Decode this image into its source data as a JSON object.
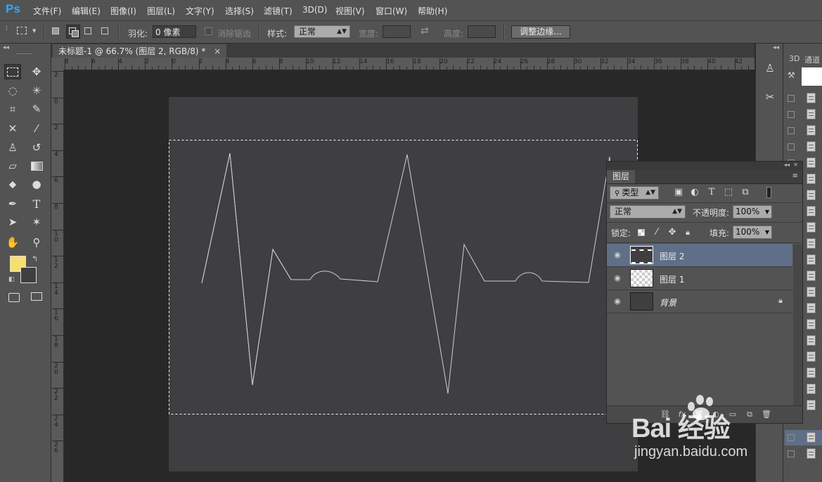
{
  "app": {
    "logo": "Ps"
  },
  "menu": [
    "文件(F)",
    "编辑(E)",
    "图像(I)",
    "图层(L)",
    "文字(Y)",
    "选择(S)",
    "滤镜(T)",
    "3D(D)",
    "视图(V)",
    "窗口(W)",
    "帮助(H)"
  ],
  "options": {
    "feather_label": "羽化:",
    "feather_value": "0 像素",
    "antialias_label": "消除锯齿",
    "style_label": "样式:",
    "style_value": "正常",
    "width_label": "宽度:",
    "height_label": "高度:",
    "refine_edge_button": "调整边缘..."
  },
  "document": {
    "tab_title": "未标题-1 @ 66.7% (图层 2, RGB/8) *",
    "close": "×"
  },
  "ruler": {
    "h_labels": [
      "8",
      "6",
      "4",
      "2",
      "0",
      "2",
      "4",
      "6",
      "8",
      "10",
      "12",
      "14",
      "16",
      "18",
      "20",
      "22",
      "24",
      "26",
      "28",
      "30",
      "32",
      "34",
      "36",
      "38",
      "40",
      "42"
    ],
    "v_labels": [
      "2",
      "0",
      "2",
      "4",
      "6",
      "8",
      "1 0",
      "1 2",
      "1 4",
      "1 6",
      "1 8",
      "2 0",
      "2 2",
      "2 4",
      "2 6"
    ]
  },
  "colors": {
    "foreground": "#f5e06e",
    "background": "#3f3e40"
  },
  "right_dock": {
    "tab_3d": "3D",
    "tab_channels": "通道"
  },
  "layers_panel": {
    "tab": "图层",
    "filter_kind": "类型",
    "blend_mode": "正常",
    "opacity_label": "不透明度:",
    "opacity_value": "100%",
    "lock_label": "锁定:",
    "fill_label": "填充:",
    "fill_value": "100%",
    "layers": [
      {
        "name": "图层 2",
        "selected": true,
        "visible": true,
        "locked": false,
        "thumb": "selection"
      },
      {
        "name": "图层 1",
        "selected": false,
        "visible": true,
        "locked": false,
        "thumb": "transparent"
      },
      {
        "name": "背景",
        "selected": false,
        "visible": true,
        "locked": true,
        "thumb": "dark",
        "italic": true
      }
    ]
  },
  "watermark": {
    "brand": "Bai 经验",
    "url": "jingyan.baidu.com"
  }
}
